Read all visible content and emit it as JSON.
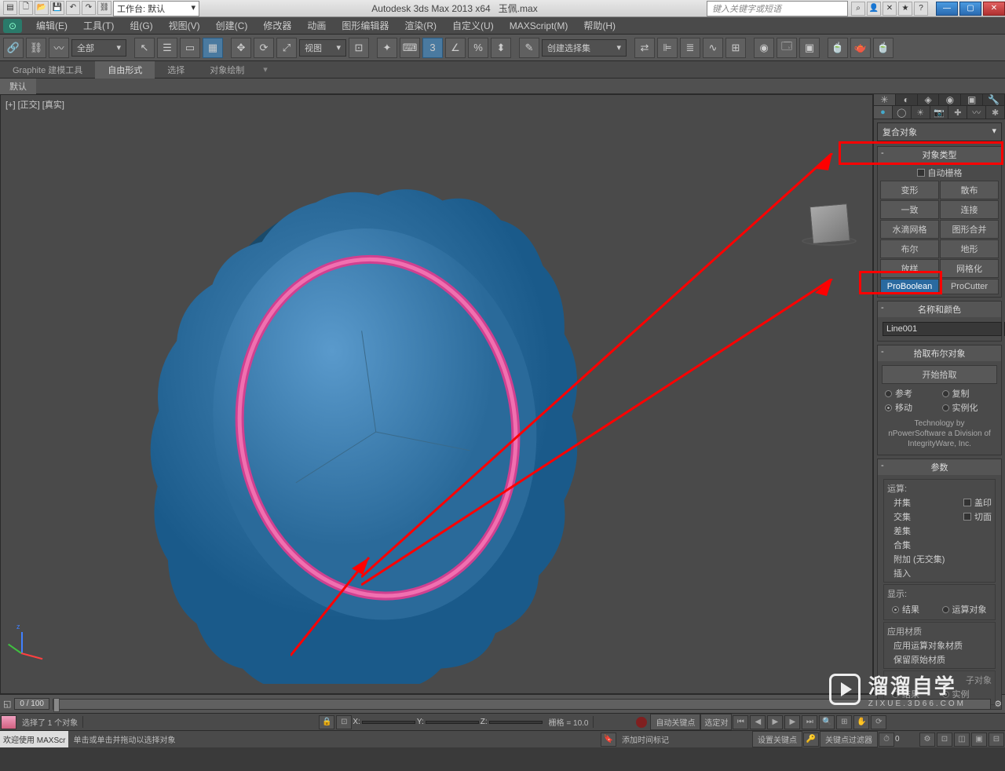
{
  "title": {
    "workspace_label": "工作台: 默认",
    "app": "Autodesk 3ds Max  2013 x64",
    "file": "玉佩.max",
    "search_ph": "键入关键字或短语"
  },
  "menu": [
    "编辑(E)",
    "工具(T)",
    "组(G)",
    "视图(V)",
    "创建(C)",
    "修改器",
    "动画",
    "图形编辑器",
    "渲染(R)",
    "自定义(U)",
    "MAXScript(M)",
    "帮助(H)"
  ],
  "toolbar": {
    "filter": "全部",
    "view": "视图",
    "selset": "创建选择集"
  },
  "ribbon": {
    "tabs": [
      "Graphite 建模工具",
      "自由形式",
      "选择",
      "对象绘制"
    ],
    "sub": "默认"
  },
  "viewport": {
    "label": "[+] [正交] [真实]",
    "axes": {
      "z": "z"
    }
  },
  "cmd": {
    "category": "复合对象",
    "object_type": {
      "title": "对象类型",
      "autogrid": "自动栅格",
      "buttons": [
        "变形",
        "散布",
        "一致",
        "连接",
        "水滴网格",
        "图形合并",
        "布尔",
        "地形",
        "放样",
        "网格化",
        "ProBoolean",
        "ProCutter"
      ]
    },
    "name_color": {
      "title": "名称和颜色",
      "value": "Line001"
    },
    "pick": {
      "title": "拾取布尔对象",
      "btn": "开始拾取",
      "radios": [
        "参考",
        "复制",
        "移动",
        "实例化"
      ]
    },
    "credit": "Technology by nPowerSoftware a Division of IntegrityWare, Inc.",
    "params": {
      "title": "参数",
      "op_title": "运算:",
      "ops": [
        "并集",
        "交集",
        "差集",
        "合集",
        "附加 (无交集)",
        "插入"
      ],
      "op_checks": [
        "盖印",
        "切面"
      ],
      "disp_title": "显示:",
      "disp": [
        "结果",
        "运算对象"
      ],
      "apply_title": "应用材质",
      "apply": [
        "应用运算对象材质",
        "保留原始材质"
      ],
      "sub_title": "子对象",
      "sub": [
        "结果",
        "实例"
      ]
    }
  },
  "timeline": {
    "frame": "0 / 100"
  },
  "status": {
    "sel": "选择了 1 个对象",
    "x": "X:",
    "y": "Y:",
    "z": "Z:",
    "grid": "栅格 = 10.0",
    "autokey": "自动关键点",
    "selkey": "选定对",
    "setkey": "设置关键点",
    "keyfilter": "关键点过滤器"
  },
  "bottom": {
    "welcome": "欢迎使用  MAXScr",
    "hint": "单击或单击并拖动以选择对象",
    "addtime": "添加时间标记"
  },
  "watermark": {
    "big": "溜溜自学",
    "small": "ZIXUE.3D66.COM"
  }
}
